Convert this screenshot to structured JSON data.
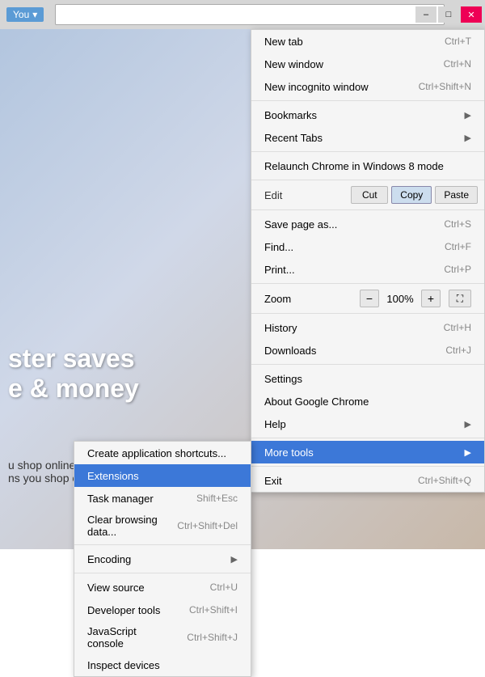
{
  "toolbar": {
    "you_label": "You",
    "you_arrow": "▾",
    "minimize": "–",
    "restore": "□",
    "close": "✕",
    "star_icon": "☆",
    "menu_icon": "≡"
  },
  "bg_text": {
    "line1": "ster saves",
    "line2": "e & money",
    "body1": "u shop online. This free",
    "body2": "ns you shop online, making sure you can"
  },
  "menu": {
    "items": [
      {
        "label": "New tab",
        "shortcut": "Ctrl+T",
        "arrow": ""
      },
      {
        "label": "New window",
        "shortcut": "Ctrl+N",
        "arrow": ""
      },
      {
        "label": "New incognito window",
        "shortcut": "Ctrl+Shift+N",
        "arrow": ""
      },
      {
        "label": "Bookmarks",
        "shortcut": "",
        "arrow": "▶"
      },
      {
        "label": "Recent Tabs",
        "shortcut": "",
        "arrow": "▶"
      },
      {
        "separator": true
      },
      {
        "label": "Relaunch Chrome in Windows 8 mode",
        "shortcut": "",
        "arrow": ""
      },
      {
        "separator": true
      },
      {
        "label": "Edit",
        "type": "edit"
      },
      {
        "separator": true
      },
      {
        "label": "Save page as...",
        "shortcut": "Ctrl+S",
        "arrow": ""
      },
      {
        "label": "Find...",
        "shortcut": "Ctrl+F",
        "arrow": ""
      },
      {
        "label": "Print...",
        "shortcut": "Ctrl+P",
        "arrow": ""
      },
      {
        "separator": true
      },
      {
        "label": "Zoom",
        "type": "zoom"
      },
      {
        "separator": true
      },
      {
        "label": "History",
        "shortcut": "Ctrl+H",
        "arrow": ""
      },
      {
        "label": "Downloads",
        "shortcut": "Ctrl+J",
        "arrow": ""
      },
      {
        "separator": true
      },
      {
        "label": "Settings",
        "shortcut": "",
        "arrow": ""
      },
      {
        "label": "About Google Chrome",
        "shortcut": "",
        "arrow": ""
      },
      {
        "label": "Help",
        "shortcut": "",
        "arrow": "▶"
      },
      {
        "separator": true
      },
      {
        "label": "More tools",
        "shortcut": "",
        "arrow": "▶",
        "highlighted": true
      },
      {
        "separator": true
      },
      {
        "label": "Exit",
        "shortcut": "Ctrl+Shift+Q",
        "arrow": ""
      }
    ],
    "edit_label": "Edit",
    "cut_label": "Cut",
    "copy_label": "Copy",
    "paste_label": "Paste",
    "zoom_label": "Zoom",
    "zoom_minus": "−",
    "zoom_value": "100%",
    "zoom_plus": "+",
    "zoom_fullscreen": "⛶"
  },
  "submenu": {
    "items": [
      {
        "label": "Create application shortcuts...",
        "shortcut": ""
      },
      {
        "label": "Extensions",
        "shortcut": "",
        "highlighted": true
      },
      {
        "label": "Task manager",
        "shortcut": "Shift+Esc"
      },
      {
        "label": "Clear browsing data...",
        "shortcut": "Ctrl+Shift+Del"
      },
      {
        "separator": true
      },
      {
        "label": "Encoding",
        "shortcut": "",
        "arrow": "▶"
      },
      {
        "separator": true
      },
      {
        "label": "View source",
        "shortcut": "Ctrl+U"
      },
      {
        "label": "Developer tools",
        "shortcut": "Ctrl+Shift+I"
      },
      {
        "label": "JavaScript console",
        "shortcut": "Ctrl+Shift+J"
      },
      {
        "label": "Inspect devices",
        "shortcut": ""
      }
    ]
  }
}
